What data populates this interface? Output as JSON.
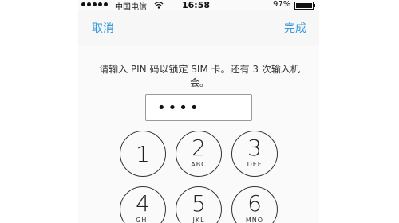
{
  "status_bar": {
    "carrier": "中国电信",
    "time": "16:58",
    "battery_percent": "97%",
    "wifi_icon": "wifi-icon",
    "battery_icon": "battery-icon"
  },
  "nav": {
    "cancel_label": "取消",
    "done_label": "完成",
    "accent_color": "#3a9bd9"
  },
  "prompt": "请输入 PIN 码以锁定 SIM 卡。还有 3 次输入机会。",
  "pin_field": {
    "value": "••••"
  },
  "keypad": [
    {
      "digit": "1",
      "letters": ""
    },
    {
      "digit": "2",
      "letters": "ABC"
    },
    {
      "digit": "3",
      "letters": "DEF"
    },
    {
      "digit": "4",
      "letters": "GHI"
    },
    {
      "digit": "5",
      "letters": "JKL"
    },
    {
      "digit": "6",
      "letters": "MNO"
    }
  ]
}
